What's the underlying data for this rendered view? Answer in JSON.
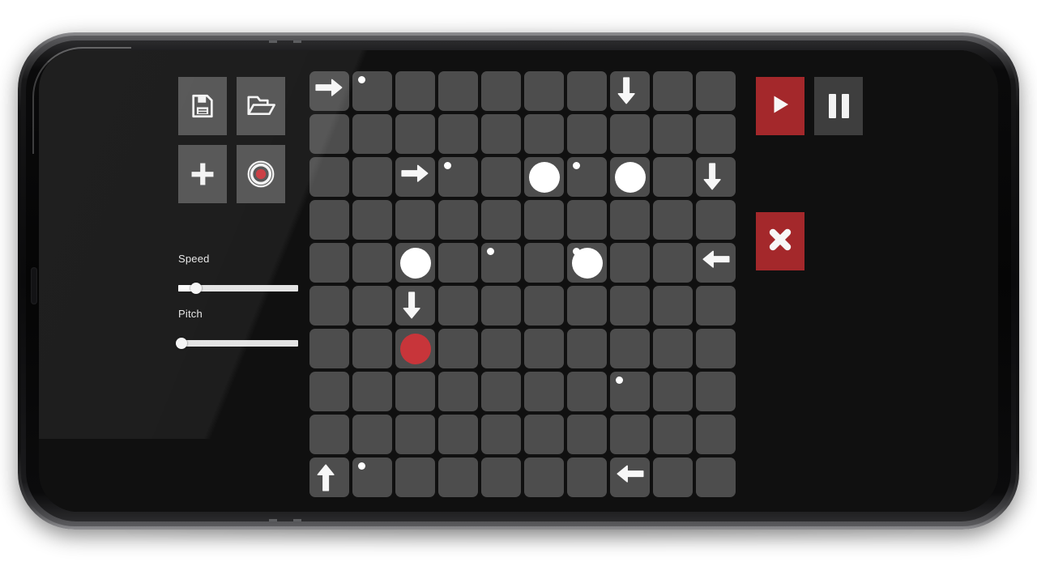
{
  "device": {
    "type": "smartphone-landscape",
    "frame_color": "#0a0a0b",
    "screen_bg": "#101010"
  },
  "theme": {
    "accent_red": "#a4282b",
    "cell_grey": "#4d4d4d",
    "button_grey": "#4f4f4f",
    "pause_grey": "#3e3e3e",
    "note_white": "#ffffff",
    "note_red": "#c8353a",
    "text": "#e6e6e6"
  },
  "toolbar": {
    "buttons": [
      {
        "name": "save-button",
        "icon": "floppy-disk-icon",
        "label": "Save"
      },
      {
        "name": "open-button",
        "icon": "open-folder-icon",
        "label": "Open"
      },
      {
        "name": "add-button",
        "icon": "plus-icon",
        "label": "Add"
      },
      {
        "name": "record-button",
        "icon": "record-icon",
        "label": "Record"
      }
    ]
  },
  "sliders": [
    {
      "name": "speed-slider",
      "label": "Speed",
      "value": 15,
      "min": 0,
      "max": 100
    },
    {
      "name": "pitch-slider",
      "label": "Pitch",
      "value": 3,
      "min": 0,
      "max": 100
    }
  ],
  "transport": {
    "play": {
      "label": "Play",
      "icon": "play-icon",
      "style": "red"
    },
    "pause": {
      "label": "Pause",
      "icon": "pause-icon",
      "style": "grey"
    },
    "clear": {
      "label": "Clear",
      "icon": "close-x-icon",
      "style": "red"
    }
  },
  "grid": {
    "rows": 10,
    "cols": 10,
    "cells": [
      [
        {
          "t": "arrow",
          "d": "right"
        },
        {
          "t": "dot"
        },
        {
          "t": "empty"
        },
        {
          "t": "empty"
        },
        {
          "t": "empty"
        },
        {
          "t": "empty"
        },
        {
          "t": "empty"
        },
        {
          "t": "arrow",
          "d": "down"
        },
        {
          "t": "empty"
        },
        {
          "t": "empty"
        }
      ],
      [
        {
          "t": "empty"
        },
        {
          "t": "empty"
        },
        {
          "t": "empty"
        },
        {
          "t": "empty"
        },
        {
          "t": "empty"
        },
        {
          "t": "empty"
        },
        {
          "t": "empty"
        },
        {
          "t": "empty"
        },
        {
          "t": "empty"
        },
        {
          "t": "empty"
        }
      ],
      [
        {
          "t": "empty"
        },
        {
          "t": "empty"
        },
        {
          "t": "arrow",
          "d": "right"
        },
        {
          "t": "dot"
        },
        {
          "t": "empty"
        },
        {
          "t": "note",
          "c": "white"
        },
        {
          "t": "dot"
        },
        {
          "t": "note",
          "c": "white"
        },
        {
          "t": "empty"
        },
        {
          "t": "arrow",
          "d": "down"
        }
      ],
      [
        {
          "t": "empty"
        },
        {
          "t": "empty"
        },
        {
          "t": "empty"
        },
        {
          "t": "empty"
        },
        {
          "t": "empty"
        },
        {
          "t": "empty"
        },
        {
          "t": "empty"
        },
        {
          "t": "empty"
        },
        {
          "t": "empty"
        },
        {
          "t": "empty"
        }
      ],
      [
        {
          "t": "empty"
        },
        {
          "t": "empty"
        },
        {
          "t": "note",
          "c": "white"
        },
        {
          "t": "empty"
        },
        {
          "t": "dot"
        },
        {
          "t": "empty"
        },
        {
          "t": "note",
          "c": "white",
          "dot": true
        },
        {
          "t": "empty"
        },
        {
          "t": "empty"
        },
        {
          "t": "arrow",
          "d": "left"
        }
      ],
      [
        {
          "t": "empty"
        },
        {
          "t": "empty"
        },
        {
          "t": "arrow",
          "d": "down"
        },
        {
          "t": "empty"
        },
        {
          "t": "empty"
        },
        {
          "t": "empty"
        },
        {
          "t": "empty"
        },
        {
          "t": "empty"
        },
        {
          "t": "empty"
        },
        {
          "t": "empty"
        }
      ],
      [
        {
          "t": "empty"
        },
        {
          "t": "empty"
        },
        {
          "t": "note",
          "c": "red"
        },
        {
          "t": "empty"
        },
        {
          "t": "empty"
        },
        {
          "t": "empty"
        },
        {
          "t": "empty"
        },
        {
          "t": "empty"
        },
        {
          "t": "empty"
        },
        {
          "t": "empty"
        }
      ],
      [
        {
          "t": "empty"
        },
        {
          "t": "empty"
        },
        {
          "t": "empty"
        },
        {
          "t": "empty"
        },
        {
          "t": "empty"
        },
        {
          "t": "empty"
        },
        {
          "t": "empty"
        },
        {
          "t": "dot"
        },
        {
          "t": "empty"
        },
        {
          "t": "empty"
        }
      ],
      [
        {
          "t": "empty"
        },
        {
          "t": "empty"
        },
        {
          "t": "empty"
        },
        {
          "t": "empty"
        },
        {
          "t": "empty"
        },
        {
          "t": "empty"
        },
        {
          "t": "empty"
        },
        {
          "t": "empty"
        },
        {
          "t": "empty"
        },
        {
          "t": "empty"
        }
      ],
      [
        {
          "t": "arrow",
          "d": "up"
        },
        {
          "t": "dot"
        },
        {
          "t": "empty"
        },
        {
          "t": "empty"
        },
        {
          "t": "empty"
        },
        {
          "t": "empty"
        },
        {
          "t": "empty"
        },
        {
          "t": "arrow",
          "d": "left"
        },
        {
          "t": "empty"
        },
        {
          "t": "empty"
        }
      ]
    ]
  }
}
